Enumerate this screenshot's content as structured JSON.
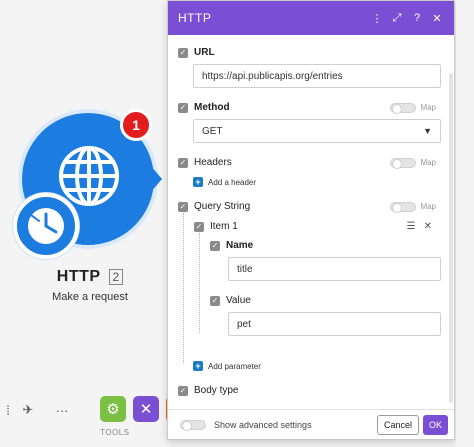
{
  "canvas": {
    "module_title": "HTTP",
    "module_count": "2",
    "module_subtitle": "Make a request",
    "badge_count": "1",
    "tools_label": "TOOLS",
    "toolbar_more": "···",
    "colors": {
      "module_blue": "#1c7ce0",
      "badge_red": "#e11d1d",
      "tool_green": "#7bc043",
      "tool_purple": "#7b4fd3",
      "tool_orange": "#f06a1b"
    }
  },
  "dialog": {
    "title": "HTTP",
    "header_icons": [
      "more-vertical-icon",
      "expand-icon",
      "help-icon",
      "close-icon"
    ],
    "url": {
      "label": "URL",
      "value": "https://api.publicapis.org/entries"
    },
    "method": {
      "label": "Method",
      "map_label": "Map",
      "selected": "GET"
    },
    "headers": {
      "label": "Headers",
      "map_label": "Map",
      "add_label": "Add a header"
    },
    "query_string": {
      "label": "Query String",
      "map_label": "Map",
      "item_label": "Item 1",
      "name_label": "Name",
      "name_value": "title",
      "value_label": "Value",
      "value_value": "pet",
      "add_label": "Add parameter"
    },
    "body_type": {
      "label": "Body type"
    },
    "footer": {
      "advanced_label": "Show advanced settings",
      "cancel_label": "Cancel",
      "ok_label": "OK"
    },
    "colors": {
      "header_purple": "#7b4fd3",
      "link_blue": "#1a7cc7"
    }
  }
}
